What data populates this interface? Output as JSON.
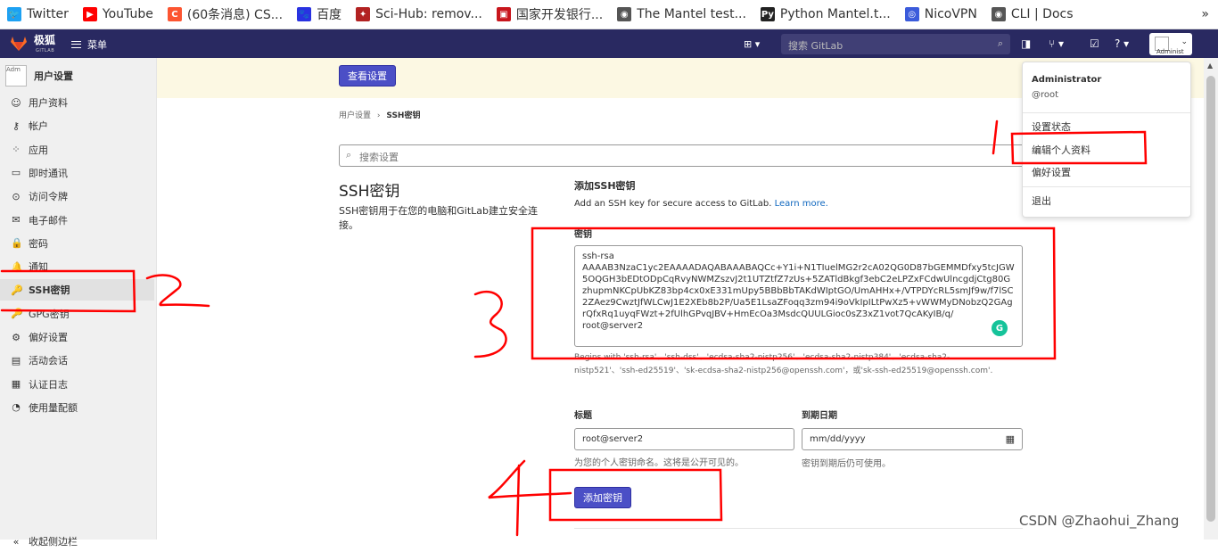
{
  "bookmarks": [
    {
      "label": "Twitter",
      "icon": "twitter-icon",
      "color": "#1da1f2",
      "glyph": "🐦"
    },
    {
      "label": "YouTube",
      "icon": "youtube-icon",
      "color": "#ff0000",
      "glyph": "▶"
    },
    {
      "label": "(60条消息) CS...",
      "icon": "csdn-icon",
      "color": "#fc5531",
      "glyph": "C"
    },
    {
      "label": "百度",
      "icon": "baidu-icon",
      "color": "#2932e1",
      "glyph": "🐾"
    },
    {
      "label": "Sci-Hub: remov...",
      "icon": "scihub-icon",
      "color": "#b22222",
      "glyph": "✦"
    },
    {
      "label": "国家开发银行...",
      "icon": "cdb-icon",
      "color": "#c8161d",
      "glyph": "▣"
    },
    {
      "label": "The Mantel test...",
      "icon": "globe-icon",
      "color": "#555555",
      "glyph": "◉"
    },
    {
      "label": "Python Mantel.t...",
      "icon": "pypi-icon",
      "color": "#222222",
      "glyph": "Py"
    },
    {
      "label": "NicoVPN",
      "icon": "nicovpn-icon",
      "color": "#3b5bdb",
      "glyph": "◎"
    },
    {
      "label": "CLI | Docs",
      "icon": "globe-icon",
      "color": "#555555",
      "glyph": "◉"
    }
  ],
  "bookmarks_more": "»",
  "topnav": {
    "logo_text": "极狐",
    "logo_sub": "GITLAB",
    "menu_label": "菜单",
    "search_placeholder": "搜索 GitLab",
    "avatar_text": "Administ"
  },
  "sidebar": {
    "avatar_alt": "Adm",
    "title": "用户设置",
    "items": [
      {
        "label": "用户资料",
        "icon": "profile-icon",
        "glyph": "☺"
      },
      {
        "label": "帐户",
        "icon": "account-icon",
        "glyph": "⚷"
      },
      {
        "label": "应用",
        "icon": "applications-icon",
        "glyph": "⁘"
      },
      {
        "label": "即时通讯",
        "icon": "chat-icon",
        "glyph": "▭"
      },
      {
        "label": "访问令牌",
        "icon": "token-icon",
        "glyph": "⊙"
      },
      {
        "label": "电子邮件",
        "icon": "email-icon",
        "glyph": "✉"
      },
      {
        "label": "密码",
        "icon": "lock-icon",
        "glyph": "🔒"
      },
      {
        "label": "通知",
        "icon": "bell-icon",
        "glyph": "🔔"
      },
      {
        "label": "SSH密钥",
        "icon": "key-icon",
        "glyph": "🔑"
      },
      {
        "label": "GPG密钥",
        "icon": "gpg-key-icon",
        "glyph": "🔑"
      },
      {
        "label": "偏好设置",
        "icon": "preferences-icon",
        "glyph": "⚙"
      },
      {
        "label": "活动会话",
        "icon": "sessions-icon",
        "glyph": "▤"
      },
      {
        "label": "认证日志",
        "icon": "log-icon",
        "glyph": "▦"
      },
      {
        "label": "使用量配额",
        "icon": "quota-icon",
        "glyph": "◔"
      }
    ],
    "active_index": 8,
    "collapse_label": "收起侧边栏"
  },
  "banner": {
    "button_label": "查看设置"
  },
  "breadcrumb": {
    "parent": "用户设置",
    "separator": "›",
    "current": "SSH密钥"
  },
  "settings_search_placeholder": "搜索设置",
  "ssh": {
    "title": "SSH密钥",
    "description": "SSH密钥用于在您的电脑和GitLab建立安全连接。"
  },
  "form": {
    "section_title": "添加SSH密钥",
    "section_desc": "Add an SSH key for secure access to GitLab.",
    "learn_more": "Learn more.",
    "key_label": "密钥",
    "key_value": "ssh-rsa\nAAAAB3NzaC1yc2EAAAADAQABAAABAQCc+Y1i+N1TIuelMG2r2cA02QG0D87bGEMMDfxy5tcJGW5OQGH3bEDtODpCqRvyNWMZszvJ2t1UTZtfZ7zUs+5ZATldBkgf3ebC2eLPZxFCdwUlncgdjCtg80GzhupmNKCpUbKZ83bp4cx0xE331mUpy5BBbBbTAKdWIptGO/UmAHHx+/VTPDYcRL5smJf9w/f7lSC2ZAez9CwztJfWLCwJ1E2XEb8b2P/Ua5E1LsaZFoqq3zm94i9oVkIpILtPwXz5+vWWMyDNobzQ2GAgrQfxRq1uyqFWzt+2fUlhGPvqJBV+HmEcOa3MsdcQUULGioc0sZ3xZ1vot7QcAKyIB/q/\nroot@server2",
    "key_help": "Begins with 'ssh-rsa'、'ssh-dss'、'ecdsa-sha2-nistp256'、'ecdsa-sha2-nistp384'、'ecdsa-sha2-nistp521'、'ssh-ed25519'、'sk-ecdsa-sha2-nistp256@openssh.com'，或'sk-ssh-ed25519@openssh.com'.",
    "title_label": "标题",
    "title_value": "root@server2",
    "title_help": "为您的个人密钥命名。这将是公开可见的。",
    "expiry_label": "到期日期",
    "expiry_placeholder": "mm/dd/yyyy",
    "expiry_help": "密钥到期后仍可使用。",
    "submit_label": "添加密钥"
  },
  "dropdown": {
    "name": "Administrator",
    "username": "@root",
    "items": [
      "设置状态",
      "编辑个人资料",
      "偏好设置"
    ],
    "signout": "退出"
  },
  "watermark": "CSDN @Zhaohui_Zhang",
  "colors": {
    "nav": "#292961",
    "primary": "#4b4fc6",
    "annotation": "#ff0000",
    "banner": "#fcf8e3"
  }
}
